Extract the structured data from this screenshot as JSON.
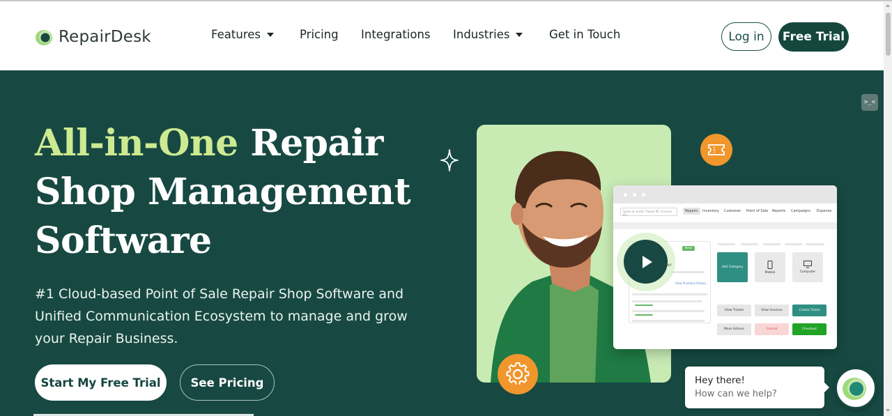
{
  "header": {
    "brand": "RepairDesk",
    "nav": [
      {
        "label": "Features",
        "has_dropdown": true
      },
      {
        "label": "Pricing",
        "has_dropdown": false
      },
      {
        "label": "Integrations",
        "has_dropdown": false
      },
      {
        "label": "Industries",
        "has_dropdown": true
      },
      {
        "label": "Get in Touch",
        "has_dropdown": false
      }
    ],
    "login_label": "Log in",
    "trial_label": "Free Trial"
  },
  "hero": {
    "title_accent": "All-in-One",
    "title_rest": " Repair Shop Management Software",
    "subtitle": "#1 Cloud-based Point of Sale Repair Shop Software and Unified Communication Ecosystem to manage and grow your Repair Business.",
    "cta_primary": "Start My Free Trial",
    "cta_secondary": "See Pricing"
  },
  "dashboard": {
    "search_placeholder": "Scan or enter Ticket ID, Invoice ID...",
    "tabs": [
      "Repairs",
      "Inventory",
      "Customer",
      "Point of Sale",
      "Reports",
      "Campaigns",
      "Expense"
    ],
    "active_tab": "Repairs",
    "tiles": [
      "Add Category",
      "Mobile",
      "Computer"
    ],
    "buttons": [
      "View Tickets",
      "View Invoices",
      "Create Ticket",
      "More Actions",
      "Cancel",
      "Checkout"
    ],
    "new_badge": "New",
    "customer_fragment": "ller",
    "purchase_link": "View Purchase History"
  },
  "chat": {
    "greeting": "Hey there!",
    "prompt": "How can we help?"
  },
  "colors": {
    "brand_dark": "#174942",
    "accent_lime": "#cdea92",
    "orange": "#f0962d",
    "mint": "#c8ebb4"
  }
}
